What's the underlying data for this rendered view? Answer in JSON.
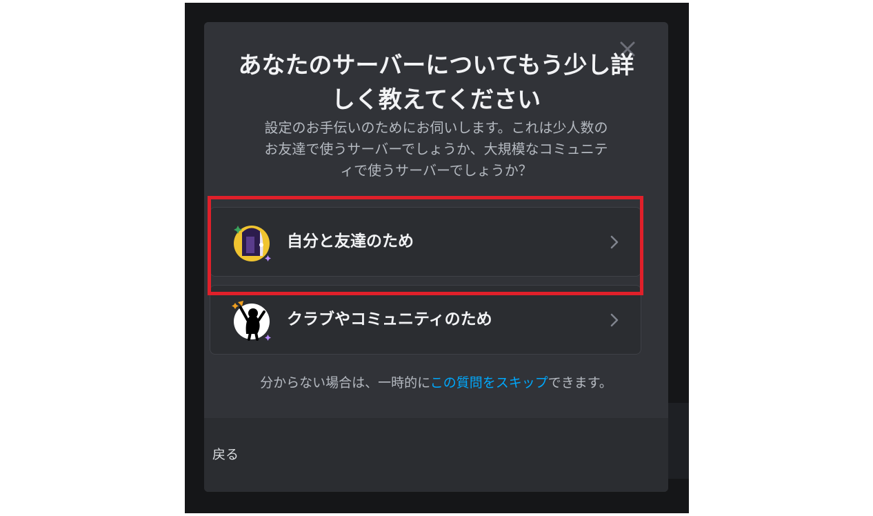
{
  "modal": {
    "title_lines": [
      "あなたのサーバーについてもう少し詳",
      "しく教えてください"
    ],
    "description_lines": [
      "設定のお手伝いのためにお伺いします。これは少人数の",
      "お友達で使うサーバーでしょうか、大規模なコミュニテ",
      "ィで使うサーバーでしょうか？"
    ],
    "options": [
      {
        "label": "自分と友達のため",
        "icon": "door-moon-icon",
        "highlighted": true
      },
      {
        "label": "クラブやコミュニティのため",
        "icon": "cheering-figure-icon",
        "highlighted": false
      }
    ],
    "hint": {
      "before": "分からない場合は、一時的に",
      "link": "この質問をスキップ",
      "after": "できます。"
    },
    "back_label": "戻る"
  },
  "colors": {
    "modal_bg": "#313338",
    "option_bg": "#2b2d31",
    "link": "#00a8fc",
    "highlight": "#e0202a"
  }
}
